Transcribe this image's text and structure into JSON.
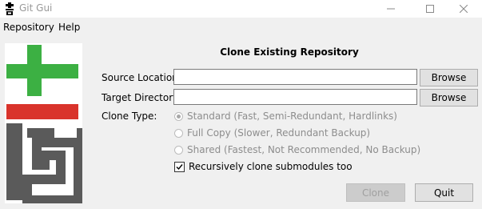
{
  "window": {
    "title": "Git Gui",
    "controls": {
      "minimize_icon": "minimize-icon",
      "maximize_icon": "maximize-icon",
      "close_icon": "close-icon"
    }
  },
  "menu": {
    "items": [
      {
        "label": "Repository"
      },
      {
        "label": "Help"
      }
    ]
  },
  "logo": {
    "icon": "git-gui-logo",
    "colors": {
      "plus": "#3cb043",
      "bar": "#d9332b",
      "letters": "#5a5a5a"
    }
  },
  "form": {
    "heading": "Clone Existing Repository",
    "source_label": "Source Location:",
    "source_value": "",
    "target_label": "Target Directory:",
    "target_value": "",
    "browse_label": "Browse",
    "clone_type_label": "Clone Type:",
    "clone_types": [
      {
        "label": "Standard (Fast, Semi-Redundant, Hardlinks)",
        "selected": true,
        "enabled": false
      },
      {
        "label": "Full Copy (Slower, Redundant Backup)",
        "selected": false,
        "enabled": false
      },
      {
        "label": "Shared (Fastest, Not Recommended, No Backup)",
        "selected": false,
        "enabled": false
      }
    ],
    "recursive_label": "Recursively clone submodules too",
    "recursive_checked": true,
    "clone_button": "Clone",
    "clone_enabled": false,
    "quit_button": "Quit"
  }
}
